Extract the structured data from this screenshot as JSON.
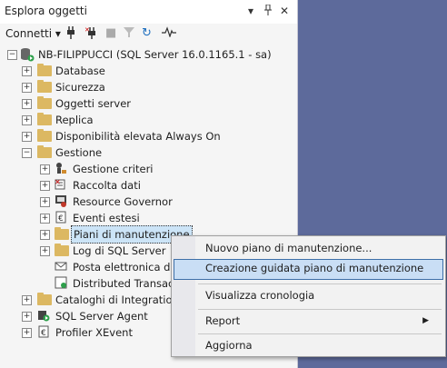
{
  "window": {
    "title": "Esplora oggetti",
    "pin_icon": "pin-icon",
    "close_icon": "close-icon"
  },
  "toolbar": {
    "connect_label": "Connetti",
    "buttons": [
      "connect-icon",
      "disconnect-icon",
      "stop-icon",
      "filter-icon",
      "refresh-icon",
      "activity-monitor-icon"
    ]
  },
  "tree": {
    "server": "NB-FILIPPUCCI (SQL Server 16.0.1165.1 - sa)",
    "nodes": {
      "database": "Database",
      "sicurezza": "Sicurezza",
      "oggetti_server": "Oggetti server",
      "replica": "Replica",
      "disponibilita": "Disponibilità elevata Always On",
      "gestione": "Gestione",
      "gestione_criteri": "Gestione criteri",
      "raccolta_dati": "Raccolta dati",
      "resource_governor": "Resource Governor",
      "eventi_estesi": "Eventi estesi",
      "piani": "Piani di manutenzione",
      "log_sql": "Log di SQL Server",
      "posta": "Posta elettronica dat",
      "dtc": "Distributed Transacti",
      "cataloghi": "Cataloghi di Integration",
      "agent": "SQL Server Agent",
      "xevent": "Profiler XEvent"
    }
  },
  "context_menu": {
    "items": [
      "Nuovo piano di manutenzione...",
      "Creazione guidata piano di manutenzione",
      "Visualizza cronologia",
      "Report",
      "Aggiorna"
    ]
  },
  "colors": {
    "background": "#5d6a9b",
    "folder": "#dcb862",
    "highlight": "#c9def5"
  }
}
